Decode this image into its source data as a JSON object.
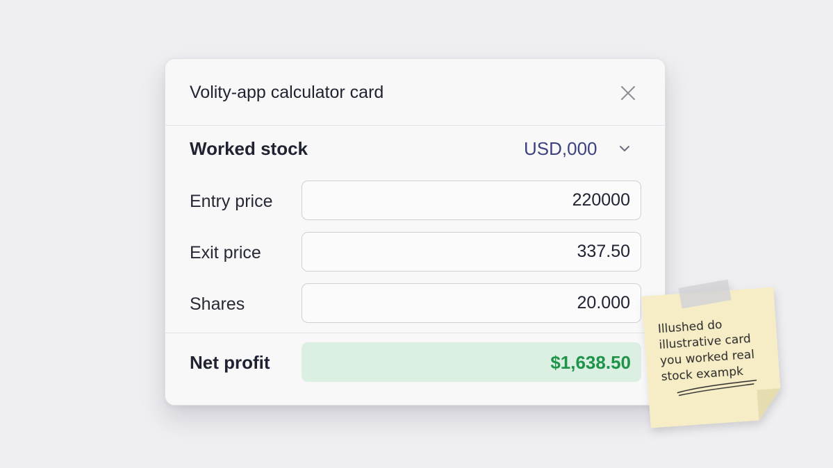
{
  "card": {
    "title": "Volity-app calculator card",
    "close_icon": "close-icon"
  },
  "stock": {
    "label": "Worked stock",
    "currency_value": "USD,000",
    "currency_icon": "chevron-down-icon"
  },
  "fields": {
    "entry_price": {
      "label": "Entry price",
      "value": "220000"
    },
    "exit_price": {
      "label": "Exit price",
      "value": "337.50"
    },
    "shares": {
      "label": "Shares",
      "value": "20.000"
    }
  },
  "result": {
    "label": "Net profit",
    "value": "$1,638.50"
  },
  "sticky_note": {
    "lines": [
      "Illushed do",
      "illustrative card",
      "you  worked real",
      "stock exampk"
    ]
  },
  "colors": {
    "accent_text": "#3c4280",
    "profit_green": "#1d9448",
    "profit_background": "#dbefe2",
    "sticky_note": "#f6edc6"
  }
}
